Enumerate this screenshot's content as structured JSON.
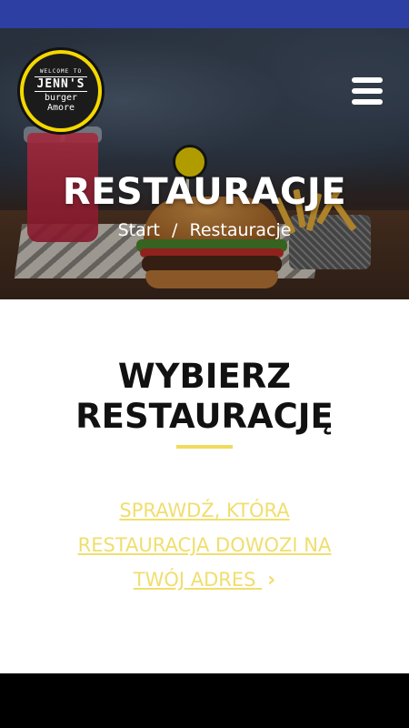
{
  "hero": {
    "title": "RESTAURACJE",
    "breadcrumb": {
      "home": "Start",
      "separator": "/",
      "current": "Restauracje"
    }
  },
  "logo": {
    "welcome": "WELCOME TO",
    "name": "JENN'S",
    "sub1": "burger",
    "sub2": "Amore"
  },
  "menu": {
    "icon": "hamburger-menu-icon"
  },
  "main": {
    "heading_line1": "WYBIERZ",
    "heading_line2": "RESTAURACJĘ",
    "link_line1": "SPRAWDŹ, KTÓRA",
    "link_line2": "RESTAURACJA DOWOZI NA",
    "link_line3": "TWÓJ ADRES",
    "link_icon": "chevron-right-icon"
  },
  "colors": {
    "status_bar": "#2e3fa3",
    "accent_yellow": "#f0de6e",
    "logo_yellow": "#f5d800"
  }
}
